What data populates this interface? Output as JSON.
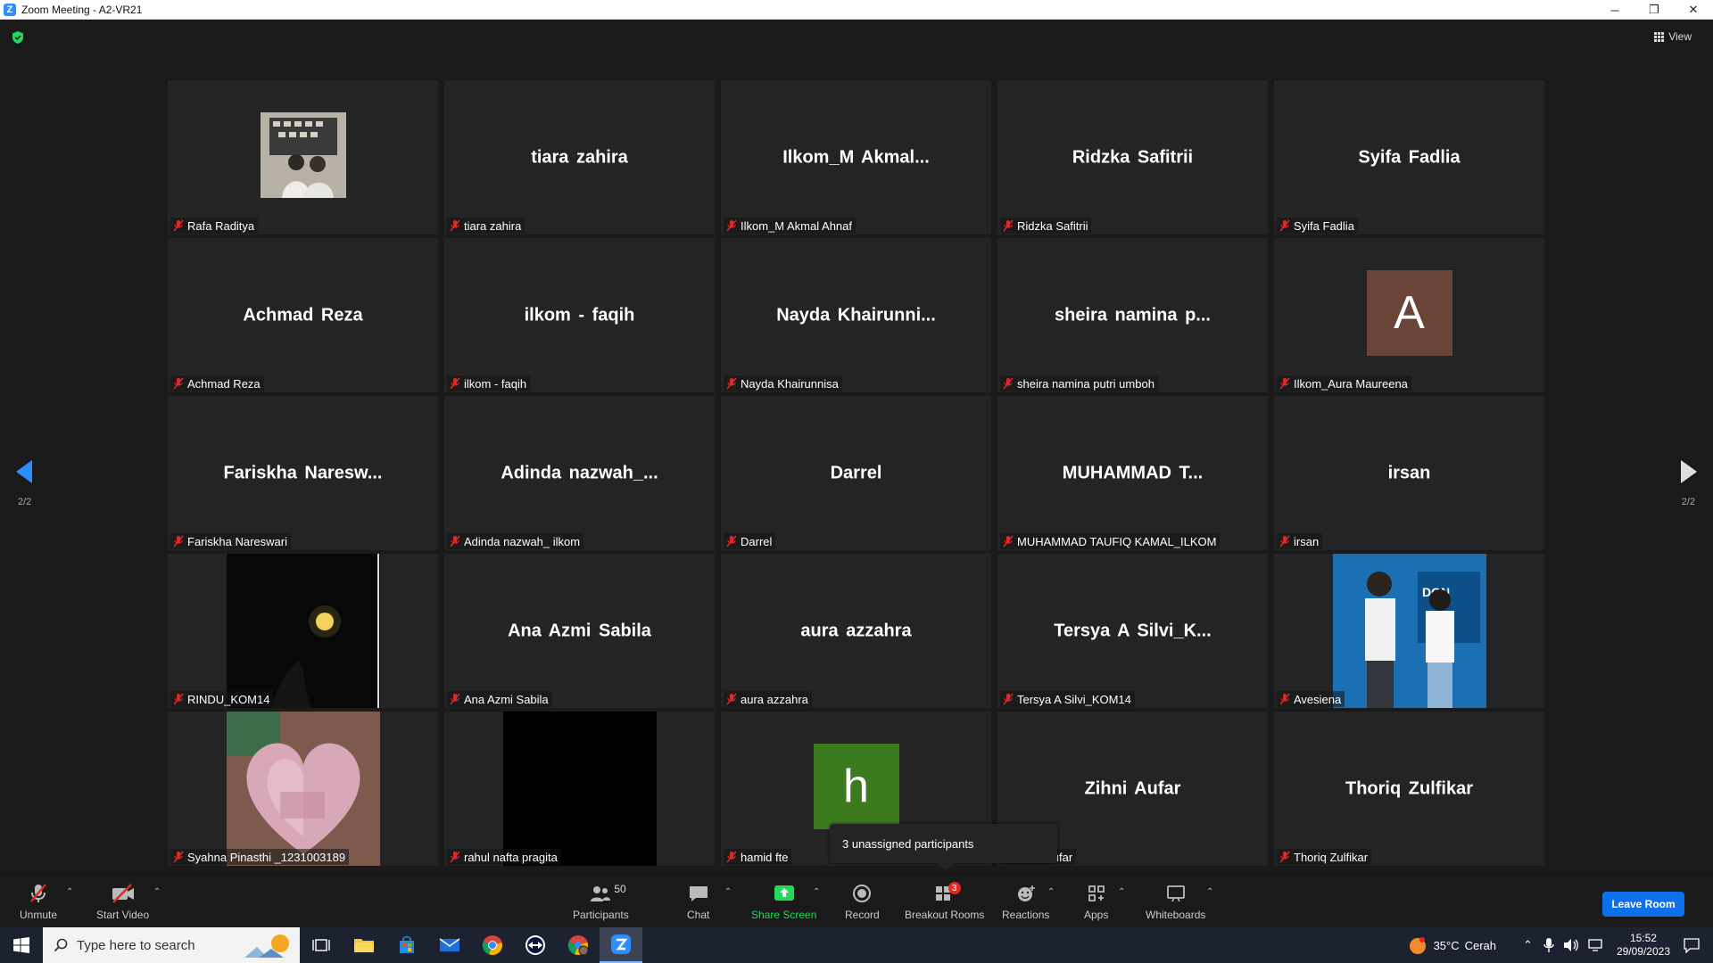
{
  "window": {
    "title": "Zoom Meeting - A2-VR21",
    "min": "─",
    "restore": "❐",
    "close": "✕"
  },
  "view_button": {
    "label": "View"
  },
  "pagination": {
    "left": "2/2",
    "right": "2/2"
  },
  "tiles": [
    {
      "display": "",
      "label": "Rafa Raditya",
      "media": "photo-room"
    },
    {
      "display": "tiara zahira",
      "label": "tiara zahira"
    },
    {
      "display": "Ilkom_M  Akmal...",
      "label": "Ilkom_M Akmal Ahnaf"
    },
    {
      "display": "Ridzka Safitrii",
      "label": "Ridzka Safitrii"
    },
    {
      "display": "Syifa Fadlia",
      "label": "Syifa Fadlia"
    },
    {
      "display": "Achmad Reza",
      "label": "Achmad Reza"
    },
    {
      "display": "ilkom - faqih",
      "label": "ilkom - faqih"
    },
    {
      "display": "Nayda  Khairunni...",
      "label": "Nayda Khairunnisa"
    },
    {
      "display": "sheira  namina  p...",
      "label": "sheira namina putri umboh"
    },
    {
      "display": "",
      "label": "Ilkom_Aura Maureena",
      "avatar_letter": "A",
      "avatar_color": "#6b4438"
    },
    {
      "display": "Fariskha  Naresw...",
      "label": "Fariskha Nareswari"
    },
    {
      "display": "Adinda  nazwah_...",
      "label": "Adinda nazwah_ ilkom"
    },
    {
      "display": "Darrel",
      "label": "Darrel"
    },
    {
      "display": "MUHAMMAD  T...",
      "label": "MUHAMMAD TAUFIQ KAMAL_ILKOM"
    },
    {
      "display": "irsan",
      "label": "irsan"
    },
    {
      "display": "",
      "label": "RINDU_KOM14",
      "media": "photo-moon"
    },
    {
      "display": "Ana Azmi Sabila",
      "label": "Ana Azmi Sabila"
    },
    {
      "display": "aura azzahra",
      "label": "aura azzahra"
    },
    {
      "display": "Tersya  A  Silvi_K...",
      "label": "Tersya A Silvi_KOM14"
    },
    {
      "display": "",
      "label": "Avesiena",
      "media": "photo-people"
    },
    {
      "display": "",
      "label": "Syahna Pinasthi _1231003189",
      "media": "photo-heart"
    },
    {
      "display": "",
      "label": "rahul nafta pragita",
      "media": "photo-black"
    },
    {
      "display": "",
      "label": "hamid fte",
      "avatar_letter": "h",
      "avatar_color": "#3c7a1f"
    },
    {
      "display": "Zihni Aufar",
      "label": "Zihni Aufar"
    },
    {
      "display": "Thoriq Zulfikar",
      "label": "Thoriq Zulfikar"
    }
  ],
  "tooltip": {
    "text": "3 unassigned participants"
  },
  "toolbar": {
    "unmute": "Unmute",
    "start_video": "Start Video",
    "participants": "Participants",
    "participants_count": "50",
    "chat": "Chat",
    "share_screen": "Share Screen",
    "record": "Record",
    "breakout_rooms": "Breakout Rooms",
    "breakout_badge": "3",
    "reactions": "Reactions",
    "apps": "Apps",
    "whiteboards": "Whiteboards",
    "leave": "Leave Room"
  },
  "colors": {
    "accent": "#2d8cff",
    "share_green": "#23d959",
    "mute_red": "#e02828",
    "leave_blue": "#0e71eb"
  },
  "taskbar": {
    "search_placeholder": "Type here to search",
    "weather_temp": "35°C",
    "weather_text": "Cerah",
    "time": "15:52",
    "date": "29/09/2023"
  }
}
